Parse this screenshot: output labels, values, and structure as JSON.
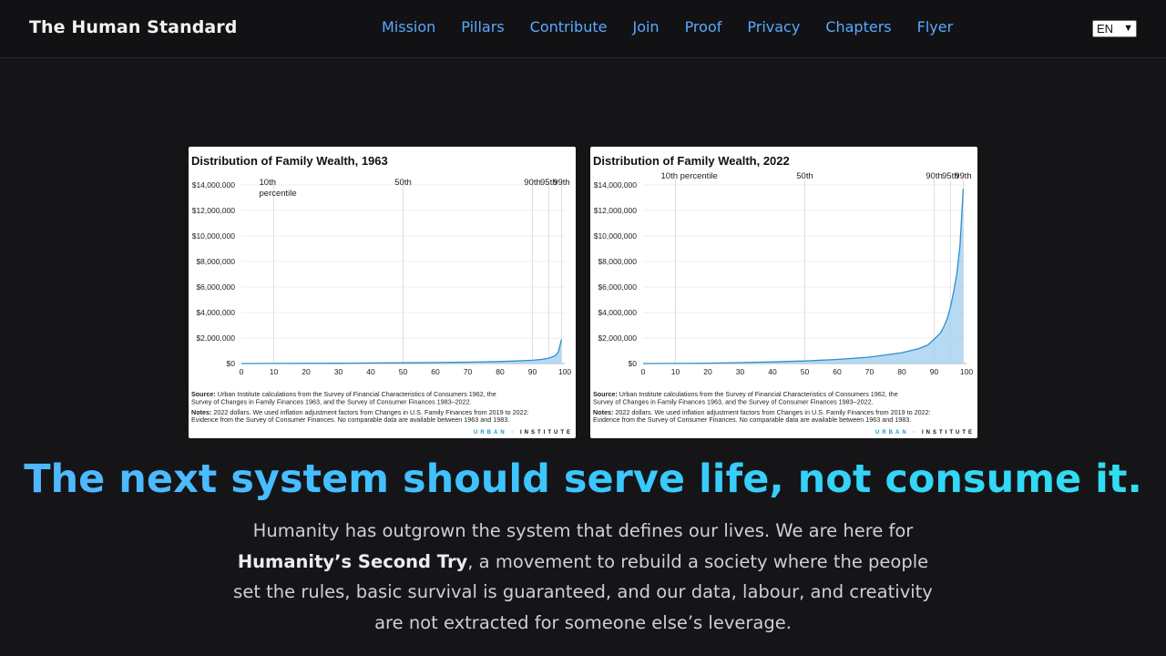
{
  "header": {
    "brand": "The Human Standard",
    "nav": [
      "Mission",
      "Pillars",
      "Contribute",
      "Join",
      "Proof",
      "Privacy",
      "Chapters",
      "Flyer"
    ],
    "language": "EN"
  },
  "chart_data": [
    {
      "type": "area",
      "title": "Distribution of Family Wealth, 1963",
      "xlabel": "",
      "ylabel": "",
      "x_ticks": [
        "0",
        "10",
        "20",
        "30",
        "40",
        "50",
        "60",
        "70",
        "80",
        "90",
        "100"
      ],
      "y_ticks": [
        "$0",
        "$2,000,000",
        "$4,000,000",
        "$6,000,000",
        "$8,000,000",
        "$10,000,000",
        "$12,000,000",
        "$14,000,000"
      ],
      "xlim": [
        0,
        100
      ],
      "ylim": [
        0,
        14000000
      ],
      "percentile_markers": [
        {
          "x": 10,
          "label": "10th",
          "label2": "percentile"
        },
        {
          "x": 50,
          "label": "50th",
          "label2": ""
        },
        {
          "x": 90,
          "label": "90th",
          "label2": ""
        },
        {
          "x": 95,
          "label": "95th",
          "label2": ""
        },
        {
          "x": 99,
          "label": "99th",
          "label2": ""
        }
      ],
      "series": [
        {
          "x": [
            0,
            10,
            20,
            30,
            40,
            50,
            60,
            70,
            80,
            85,
            90,
            93,
            95,
            97,
            98,
            99
          ],
          "y": [
            0,
            5000,
            15000,
            25000,
            40000,
            60000,
            80000,
            110000,
            160000,
            200000,
            260000,
            330000,
            420000,
            600000,
            900000,
            1900000
          ]
        }
      ],
      "source_label": "Source:",
      "source": "Urban Institute calculations from the Survey of Financial Characteristics of Consumers 1962, the Survey of Changes in Family Finances 1963, and the Survey of Consumer Finances 1983–2022.",
      "notes_label": "Notes:",
      "notes": "2022 dollars. We used inflation adjustment factors from Changes in U.S. Family Finances from 2019 to 2022: Evidence from the Survey of Consumer Finances. No comparable data are available between 1963 and 1983.",
      "brand_a": "URBAN",
      "brand_b": "INSTITUTE"
    },
    {
      "type": "area",
      "title": "Distribution of Family Wealth, 2022",
      "xlabel": "",
      "ylabel": "",
      "x_ticks": [
        "0",
        "10",
        "20",
        "30",
        "40",
        "50",
        "60",
        "70",
        "80",
        "90",
        "100"
      ],
      "y_ticks": [
        "$0",
        "$2,000,000",
        "$4,000,000",
        "$6,000,000",
        "$8,000,000",
        "$10,000,000",
        "$12,000,000",
        "$14,000,000"
      ],
      "xlim": [
        0,
        100
      ],
      "ylim": [
        0,
        14000000
      ],
      "percentile_markers": [
        {
          "x": 10,
          "label": "10th percentile",
          "label2": ""
        },
        {
          "x": 50,
          "label": "50th",
          "label2": ""
        },
        {
          "x": 90,
          "label": "90th",
          "label2": ""
        },
        {
          "x": 95,
          "label": "95th",
          "label2": ""
        },
        {
          "x": 99,
          "label": "99th",
          "label2": ""
        }
      ],
      "series": [
        {
          "x": [
            0,
            10,
            20,
            30,
            40,
            50,
            60,
            70,
            80,
            85,
            88,
            90,
            92,
            93,
            94,
            95,
            96,
            97,
            98,
            99
          ],
          "y": [
            0,
            10000,
            30000,
            70000,
            130000,
            200000,
            320000,
            500000,
            850000,
            1150000,
            1450000,
            1900000,
            2400000,
            2900000,
            3500000,
            4400000,
            5600000,
            7000000,
            9300000,
            13700000
          ]
        }
      ],
      "source_label": "Source:",
      "source": "Urban Institute calculations from the Survey of Financial Characteristics of Consumers 1962, the Survey of Changes in Family Finances 1963, and the Survey of Consumer Finances 1983–2022.",
      "notes_label": "Notes:",
      "notes": "2022 dollars. We used inflation adjustment factors from Changes in U.S. Family Finances from 2019 to 2022: Evidence from the Survey of Consumer Finances. No comparable data are available between 1963 and 1983.",
      "brand_a": "URBAN",
      "brand_b": "INSTITUTE"
    }
  ],
  "colors": {
    "accent": "#5aa9ff",
    "curve": "#2d8fcf",
    "fill": "#a8d4f0",
    "headline_start": "#52b6ff",
    "headline_end": "#2fe0f2",
    "background": "#151518"
  },
  "hero": {
    "headline": "The next system should serve life, not consume it.",
    "lead_1": "Humanity has outgrown the system that defines our lives. We are here for",
    "lead_strong": "Humanity’s Second Try",
    "lead_2": ", a movement to rebuild a society where the people set the rules, basic survival is guaranteed, and our data, labour, and creativity are not extracted for someone else’s leverage."
  }
}
